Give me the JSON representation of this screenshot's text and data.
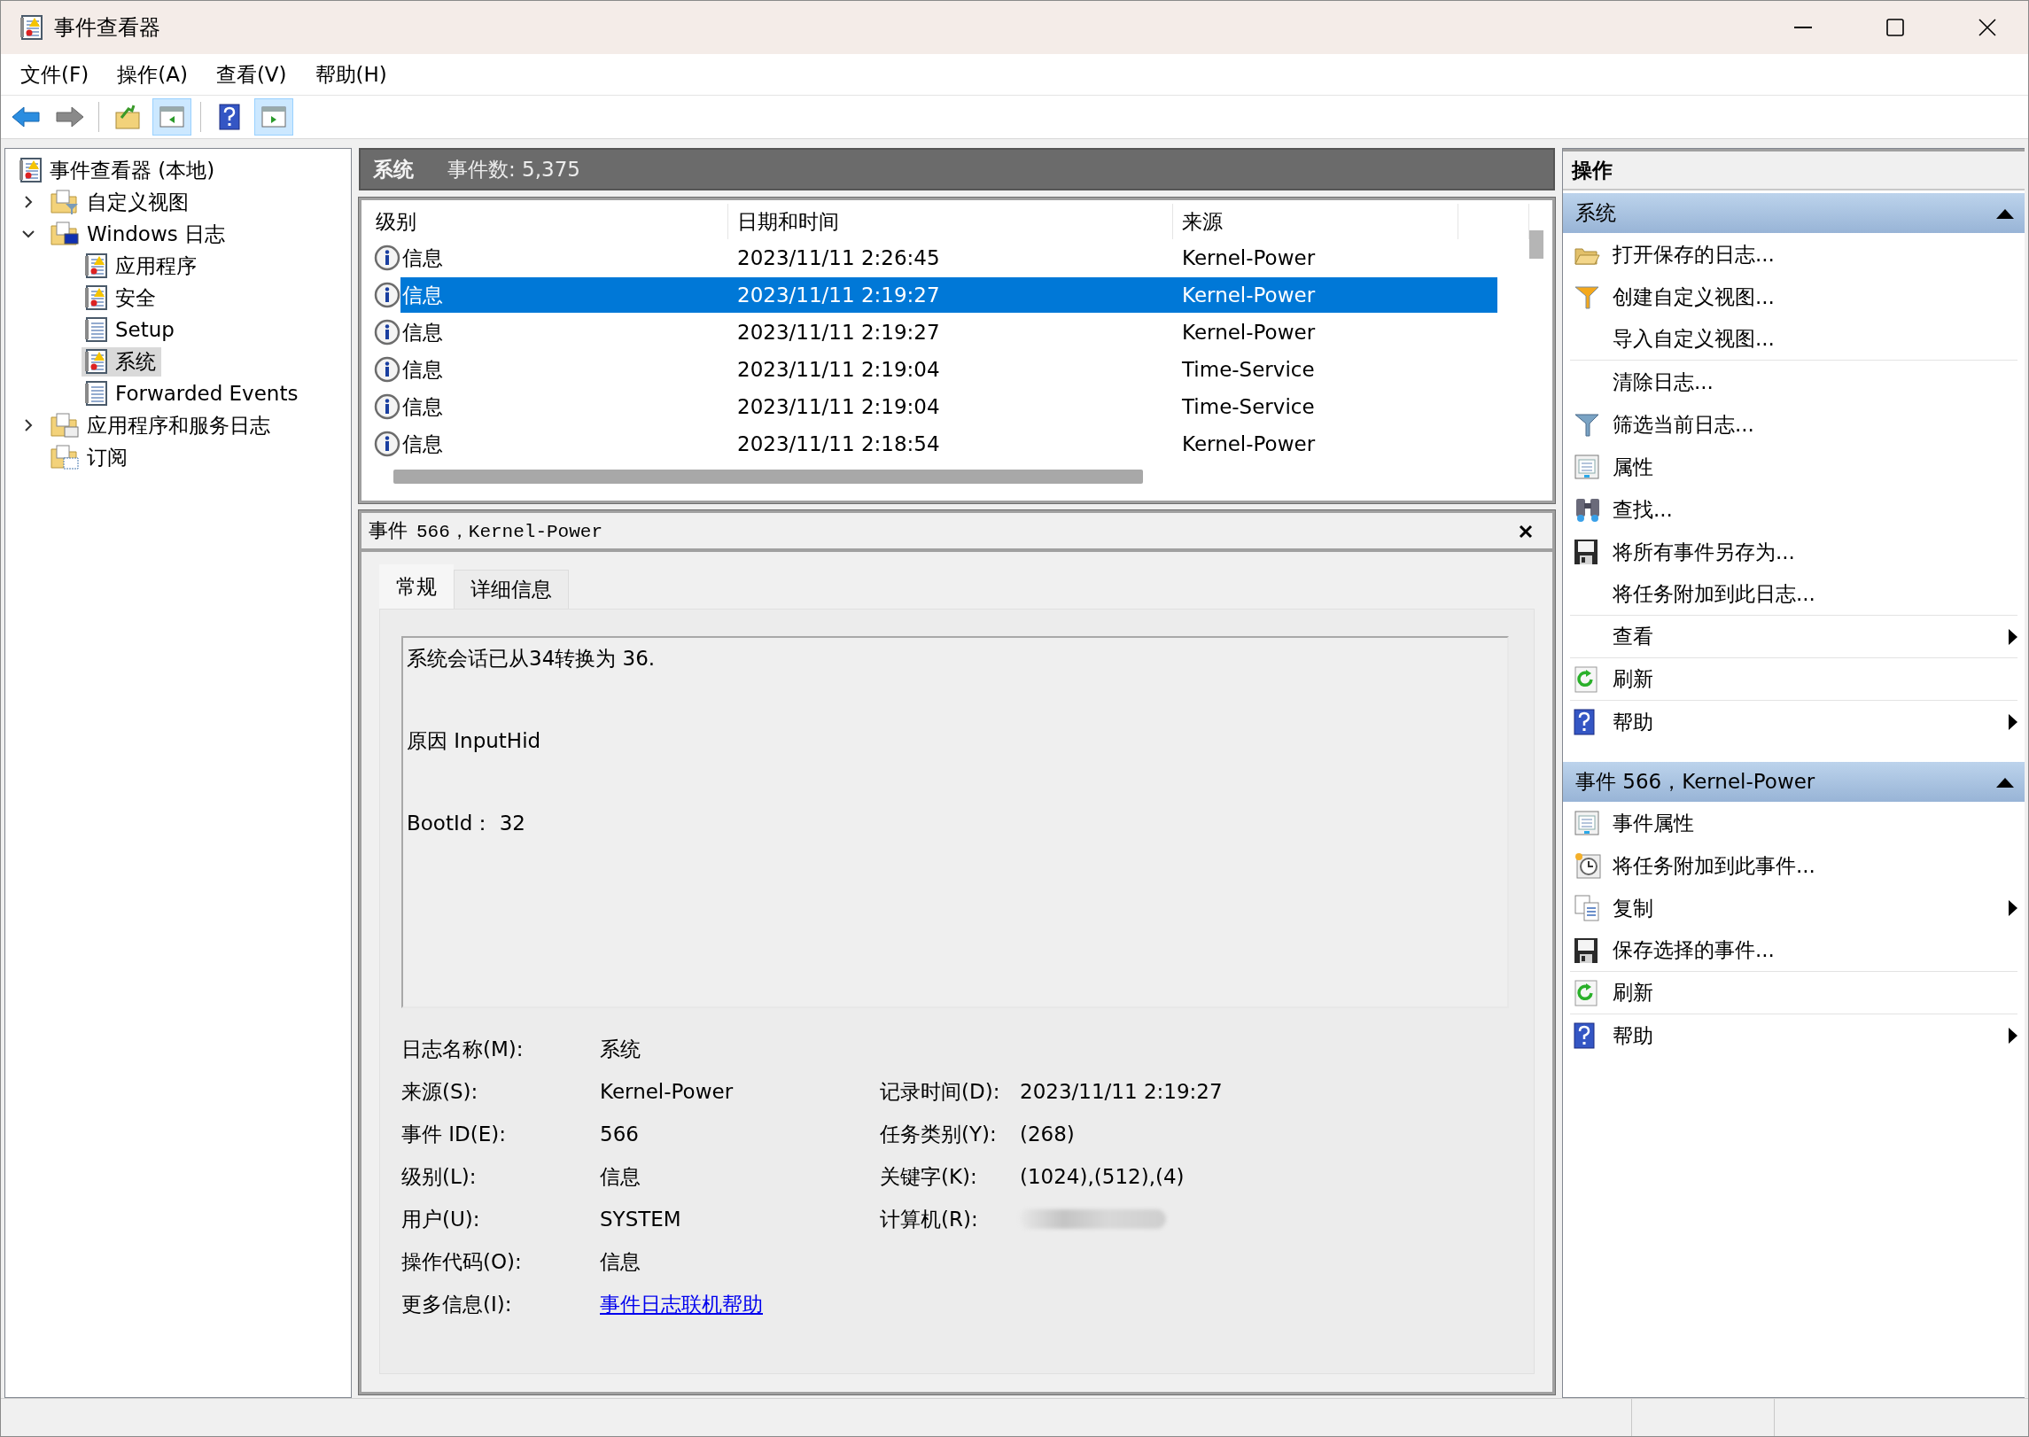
{
  "window": {
    "title": "事件查看器"
  },
  "menu": [
    "文件(F)",
    "操作(A)",
    "查看(V)",
    "帮助(H)"
  ],
  "toolbar": [
    {
      "kind": "back",
      "pressed": false
    },
    {
      "kind": "forward",
      "pressed": false
    },
    {
      "kind": "up",
      "pressed": false
    },
    {
      "kind": "tree",
      "pressed": true
    },
    {
      "kind": "help",
      "pressed": false
    },
    {
      "kind": "actions",
      "pressed": true
    }
  ],
  "tree": [
    {
      "label": "事件查看器 (本地)",
      "kind": "viewer",
      "selected": false,
      "children": [
        {
          "label": "自定义视图",
          "kind": "filter",
          "selected": false,
          "expanded": false
        },
        {
          "label": "Windows 日志",
          "kind": "windows",
          "selected": false,
          "expanded": true,
          "children": [
            {
              "label": "应用程序",
              "kind": "log",
              "selected": false
            },
            {
              "label": "安全",
              "kind": "log",
              "selected": false
            },
            {
              "label": "Setup",
              "kind": "plain",
              "selected": false
            },
            {
              "label": "系统",
              "kind": "log",
              "selected": true
            },
            {
              "label": "Forwarded Events",
              "kind": "plain",
              "selected": false
            }
          ]
        },
        {
          "label": "应用程序和服务日志",
          "kind": "folder",
          "selected": false,
          "expanded": false
        },
        {
          "label": "订阅",
          "kind": "subscription",
          "selected": false
        }
      ]
    }
  ],
  "log_view": {
    "title": "系统",
    "count": "事件数: 5,375",
    "columns": [
      "级别",
      "日期和时间",
      "来源"
    ],
    "rows": [
      {
        "level": "信息",
        "date": "2023/11/11 2:26:45",
        "source": "Kernel-Power",
        "selected": false
      },
      {
        "level": "信息",
        "date": "2023/11/11 2:19:27",
        "source": "Kernel-Power",
        "selected": true
      },
      {
        "level": "信息",
        "date": "2023/11/11 2:19:27",
        "source": "Kernel-Power",
        "selected": false
      },
      {
        "level": "信息",
        "date": "2023/11/11 2:19:04",
        "source": "Time-Service",
        "selected": false
      },
      {
        "level": "信息",
        "date": "2023/11/11 2:19:04",
        "source": "Time-Service",
        "selected": false
      },
      {
        "level": "信息",
        "date": "2023/11/11 2:18:54",
        "source": "Kernel-Power",
        "selected": false
      }
    ]
  },
  "event_detail": {
    "title_label": "事件",
    "title_value": "566，Kernel-Power",
    "tabs": [
      {
        "label": "常规",
        "selected": true
      },
      {
        "label": "详细信息",
        "selected": false
      }
    ],
    "message": [
      "系统会话已从34转换为 36.",
      "原因 InputHid",
      "BootId： 32"
    ],
    "properties_left": [
      {
        "label": "日志名称(M):",
        "value": "系统",
        "kind": "text"
      },
      {
        "label": "来源(S):",
        "value": "Kernel-Power",
        "kind": "text"
      },
      {
        "label": "事件 ID(E):",
        "value": "566",
        "kind": "text"
      },
      {
        "label": "级别(L):",
        "value": "信息",
        "kind": "text"
      },
      {
        "label": "用户(U):",
        "value": "SYSTEM",
        "kind": "text"
      },
      {
        "label": "操作代码(O):",
        "value": "信息",
        "kind": "text"
      },
      {
        "label": "更多信息(I):",
        "value": "事件日志联机帮助",
        "kind": "link"
      }
    ],
    "properties_right": [
      {
        "label": "记录时间(D):",
        "value": "2023/11/11 2:19:27",
        "kind": "text"
      },
      {
        "label": "任务类别(Y):",
        "value": "(268)",
        "kind": "text"
      },
      {
        "label": "关键字(K):",
        "value": "(1024),(512),(4)",
        "kind": "text"
      },
      {
        "label": "计算机(R):",
        "kind": "redacted"
      }
    ]
  },
  "actions": {
    "title": "操作",
    "sections": [
      {
        "title": "系统",
        "expanded": true,
        "items": [
          {
            "label": "打开保存的日志...",
            "kind": "open",
            "submenu": false,
            "divider": false
          },
          {
            "label": "创建自定义视图...",
            "kind": "create-view",
            "submenu": false,
            "divider": false
          },
          {
            "label": "导入自定义视图...",
            "kind": "plain",
            "submenu": false,
            "divider": true
          },
          {
            "label": "清除日志...",
            "kind": "plain",
            "submenu": false,
            "divider": false
          },
          {
            "label": "筛选当前日志...",
            "kind": "filter",
            "submenu": false,
            "divider": false
          },
          {
            "label": "属性",
            "kind": "properties",
            "submenu": false,
            "divider": false
          },
          {
            "label": "查找...",
            "kind": "find",
            "submenu": false,
            "divider": false
          },
          {
            "label": "将所有事件另存为...",
            "kind": "save",
            "submenu": false,
            "divider": false
          },
          {
            "label": "将任务附加到此日志...",
            "kind": "plain",
            "submenu": false,
            "divider": true
          },
          {
            "label": "查看",
            "kind": "plain",
            "submenu": true,
            "divider": true
          },
          {
            "label": "刷新",
            "kind": "refresh",
            "submenu": false,
            "divider": true
          },
          {
            "label": "帮助",
            "kind": "help",
            "submenu": true,
            "divider": false
          }
        ]
      },
      {
        "title": "事件 566，Kernel-Power",
        "expanded": true,
        "items": [
          {
            "label": "事件属性",
            "kind": "properties",
            "submenu": false,
            "divider": false
          },
          {
            "label": "将任务附加到此事件...",
            "kind": "task",
            "submenu": false,
            "divider": false
          },
          {
            "label": "复制",
            "kind": "copy",
            "submenu": true,
            "divider": false
          },
          {
            "label": "保存选择的事件...",
            "kind": "save",
            "submenu": false,
            "divider": true
          },
          {
            "label": "刷新",
            "kind": "refresh",
            "submenu": false,
            "divider": true
          },
          {
            "label": "帮助",
            "kind": "help",
            "submenu": true,
            "divider": false
          }
        ]
      }
    ]
  }
}
